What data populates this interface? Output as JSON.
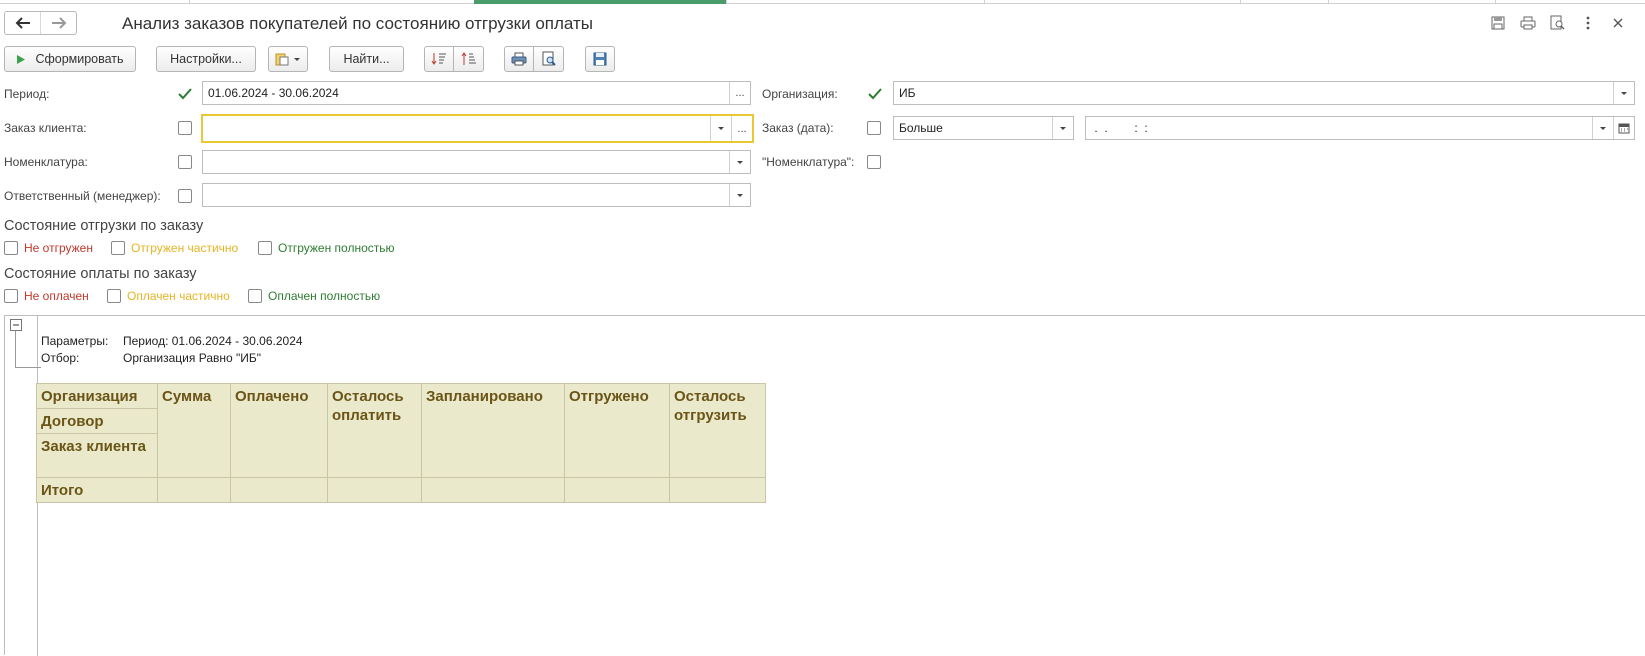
{
  "window": {
    "title": "Анализ заказов покупателей по состоянию отгрузки оплаты",
    "nav_back_icon": "arrow-left-icon",
    "nav_forward_icon": "arrow-right-icon",
    "header_icons": [
      "save-icon",
      "print-icon",
      "preview-icon",
      "more-icon",
      "close-icon"
    ]
  },
  "toolbar": {
    "generate_label": "Сформировать",
    "settings_label": "Настройки...",
    "find_label": "Найти..."
  },
  "filters": {
    "period": {
      "label": "Период:",
      "checked": true,
      "value": "01.06.2024 - 30.06.2024",
      "ellipsis": "..."
    },
    "organization": {
      "label": "Организация:",
      "checked": true,
      "value": "ИБ"
    },
    "customer_order": {
      "label": "Заказ клиента:",
      "checked": false,
      "value": "",
      "ellipsis": "..."
    },
    "order_date": {
      "label": "Заказ (дата):",
      "checked": false,
      "comparison": "Больше",
      "date_value": " .  .        :  :"
    },
    "nomenclature": {
      "label": "Номенклатура:",
      "checked": false,
      "value": ""
    },
    "nomenclature_flag": {
      "label": "\"Номенклатура\":",
      "checked": false
    },
    "manager": {
      "label": "Ответственный (менеджер):",
      "checked": false,
      "value": ""
    }
  },
  "shipment_state": {
    "title": "Состояние отгрузки по заказу",
    "options": [
      {
        "label": "Не отгружен",
        "color": "#c0392b",
        "checked": false
      },
      {
        "label": "Отгружен частично",
        "color": "#e6b422",
        "checked": false
      },
      {
        "label": "Отгружен полностью",
        "color": "#2e7d32",
        "checked": false
      }
    ]
  },
  "payment_state": {
    "title": "Состояние оплаты по заказу",
    "options": [
      {
        "label": "Не оплачен",
        "color": "#c0392b",
        "checked": false
      },
      {
        "label": "Оплачен частично",
        "color": "#e6b422",
        "checked": false
      },
      {
        "label": "Оплачен полностью",
        "color": "#2e7d32",
        "checked": false
      }
    ]
  },
  "report": {
    "params_label": "Параметры:",
    "params_value": "Период: 01.06.2024 - 30.06.2024",
    "filter_label": "Отбор:",
    "filter_value": "Организация Равно \"ИБ\"",
    "headers": {
      "organization": "Организация",
      "contract": "Договор",
      "customer_order": "Заказ клиента",
      "sum": "Сумма",
      "paid": "Оплачено",
      "remaining_to_pay": "Осталось оплатить",
      "planned": "Запланировано",
      "shipped": "Отгружено",
      "remaining_to_ship": "Осталось отгрузить"
    },
    "total_label": "Итого"
  }
}
